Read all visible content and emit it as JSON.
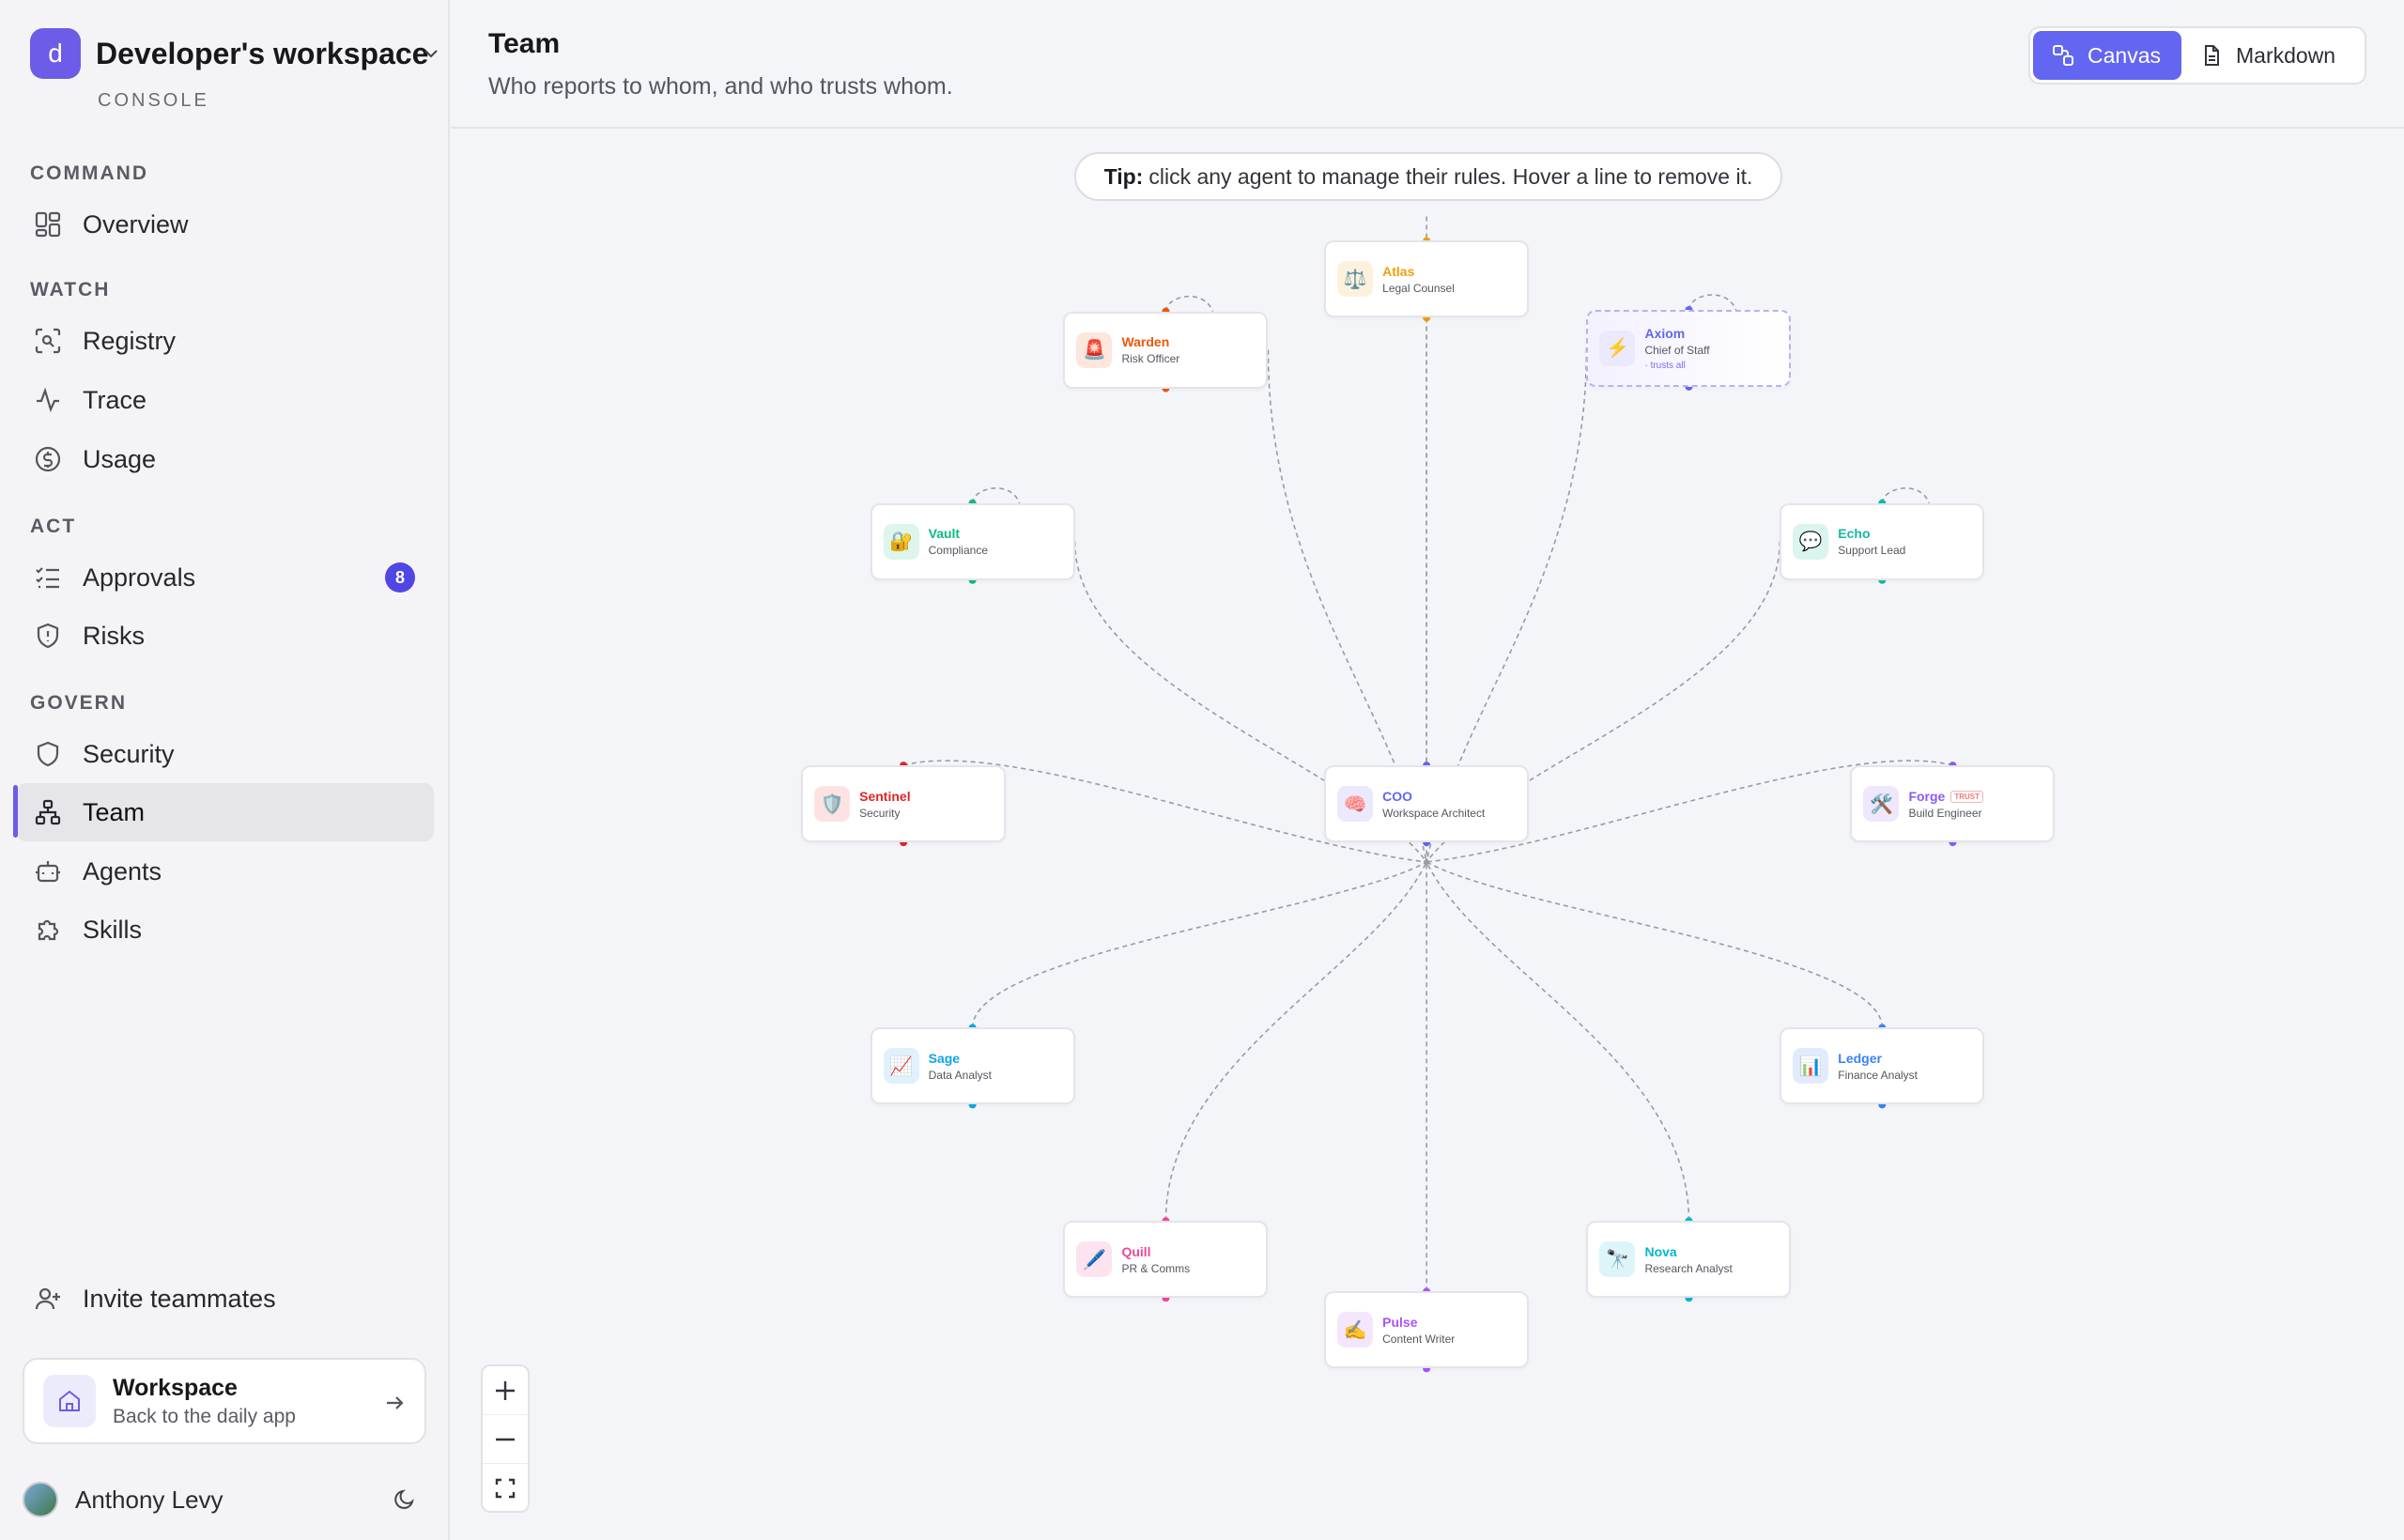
{
  "workspace": {
    "initial": "d",
    "name": "Developer's workspace",
    "subtitle": "CONSOLE"
  },
  "nav": {
    "sections": [
      "COMMAND",
      "WATCH",
      "ACT",
      "GOVERN"
    ],
    "items": [
      {
        "label": "Overview",
        "icon": "grid-icon"
      },
      {
        "label": "Registry",
        "icon": "scan-icon"
      },
      {
        "label": "Trace",
        "icon": "activity-icon"
      },
      {
        "label": "Usage",
        "icon": "dollar-icon"
      },
      {
        "label": "Approvals",
        "icon": "checklist-icon",
        "badge": "8"
      },
      {
        "label": "Risks",
        "icon": "shield-alert-icon"
      },
      {
        "label": "Security",
        "icon": "shield-icon"
      },
      {
        "label": "Team",
        "icon": "org-chart-icon",
        "active": true
      },
      {
        "label": "Agents",
        "icon": "bot-icon"
      },
      {
        "label": "Skills",
        "icon": "puzzle-icon"
      }
    ],
    "invite": "Invite teammates"
  },
  "workspace_card": {
    "title": "Workspace",
    "subtitle": "Back to the daily app"
  },
  "user": {
    "name": "Anthony Levy"
  },
  "header": {
    "title": "Team",
    "subtitle": "Who reports to whom, and who trusts whom."
  },
  "view_toggle": {
    "canvas": "Canvas",
    "markdown": "Markdown",
    "selected": "Canvas"
  },
  "tip": {
    "prefix": "Tip:",
    "text": "click any agent to manage their rules. Hover a line to remove it."
  },
  "agents": [
    {
      "key": "atlas",
      "name": "Atlas",
      "role": "Legal Counsel",
      "emoji": "⚖️",
      "color": "#f59e0b",
      "tint": "#fdf1dd"
    },
    {
      "key": "warden",
      "name": "Warden",
      "role": "Risk Officer",
      "emoji": "🚨",
      "color": "#ea580c",
      "tint": "#fde6dc"
    },
    {
      "key": "axiom",
      "name": "Axiom",
      "role": "Chief of Staff",
      "emoji": "⚡",
      "color": "#6366f1",
      "tint": "#ebe9fd",
      "extra": "· trusts all"
    },
    {
      "key": "vault",
      "name": "Vault",
      "role": "Compliance",
      "emoji": "🔐",
      "color": "#10b981",
      "tint": "#ddf5ea"
    },
    {
      "key": "echo",
      "name": "Echo",
      "role": "Support Lead",
      "emoji": "💬",
      "color": "#14b8a6",
      "tint": "#daf4f0"
    },
    {
      "key": "sentinel",
      "name": "Sentinel",
      "role": "Security",
      "emoji": "🛡️",
      "color": "#dc2626",
      "tint": "#fde2e2"
    },
    {
      "key": "coo",
      "name": "COO",
      "role": "Workspace Architect",
      "emoji": "🧠",
      "color": "#6366f1",
      "tint": "#ebe9fd"
    },
    {
      "key": "forge",
      "name": "Forge",
      "role": "Build Engineer",
      "emoji": "🛠️",
      "color": "#8b5cf6",
      "tint": "#eee7fd",
      "badge": "TRUST"
    },
    {
      "key": "sage",
      "name": "Sage",
      "role": "Data Analyst",
      "emoji": "📈",
      "color": "#0ea5e9",
      "tint": "#dff1fb"
    },
    {
      "key": "ledger",
      "name": "Ledger",
      "role": "Finance Analyst",
      "emoji": "📊",
      "color": "#3b82f6",
      "tint": "#e2ebfd"
    },
    {
      "key": "quill",
      "name": "Quill",
      "role": "PR & Comms",
      "emoji": "🖊️",
      "color": "#ec4899",
      "tint": "#fde3f0"
    },
    {
      "key": "nova",
      "name": "Nova",
      "role": "Research Analyst",
      "emoji": "🔭",
      "color": "#06b6d4",
      "tint": "#ddf5f9"
    },
    {
      "key": "pulse",
      "name": "Pulse",
      "role": "Content Writer",
      "emoji": "✍️",
      "color": "#a855f7",
      "tint": "#f3e6fd"
    }
  ]
}
